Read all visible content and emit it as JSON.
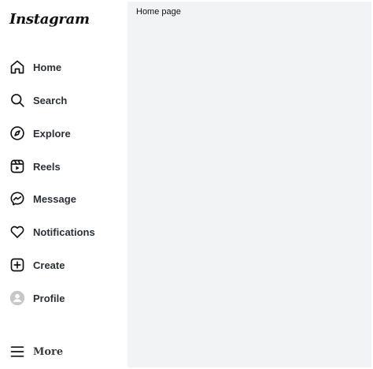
{
  "app": {
    "logo_text": "Instagram"
  },
  "sidebar": {
    "items": [
      {
        "label": "Home",
        "icon": "home-icon"
      },
      {
        "label": "Search",
        "icon": "search-icon"
      },
      {
        "label": "Explore",
        "icon": "compass-icon"
      },
      {
        "label": "Reels",
        "icon": "reels-icon"
      },
      {
        "label": "Message",
        "icon": "messenger-icon"
      },
      {
        "label": "Notifications",
        "icon": "heart-icon"
      },
      {
        "label": "Create",
        "icon": "plus-square-icon"
      },
      {
        "label": "Profile",
        "icon": "avatar-icon"
      }
    ],
    "more": {
      "label": "More",
      "icon": "hamburger-menu-icon"
    }
  },
  "main": {
    "title": "Home page"
  },
  "colors": {
    "main_background": "#f2f3f5",
    "sidebar_background": "#ffffff",
    "label_text": "#2b2f36"
  }
}
